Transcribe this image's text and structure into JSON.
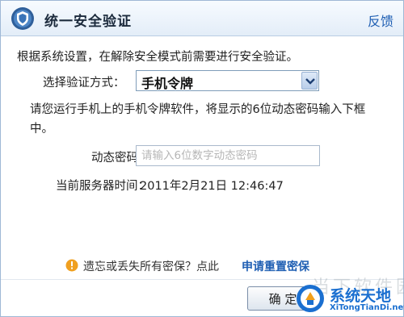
{
  "window": {
    "title": "统一安全验证",
    "feedback_link": "反馈"
  },
  "intro_text": "根据系统设置，在解除安全模式前需要进行安全验证。",
  "verify_method": {
    "label": "选择验证方式：",
    "selected": "手机令牌"
  },
  "description": "请您运行手机上的手机令牌软件，将显示的6位动态密码输入下框中。",
  "otp": {
    "label": "动态密码：",
    "placeholder": "请输入6位数字动态密码",
    "value": ""
  },
  "server_time": {
    "label": "当前服务器时间：",
    "value": "2011年2月21日 12:46:47"
  },
  "help": {
    "text": "遗忘或丢失所有密保？点此",
    "link": "申请重置密保"
  },
  "ok_button": "确 定",
  "watermark": {
    "background_text": "当下软件园",
    "name": "系统天地",
    "url": "XiTongTianDi.net"
  },
  "icons": {
    "title": "shield-icon",
    "dropdown": "chevron-down-icon",
    "help": "info-icon",
    "watermark": "site-logo-icon"
  },
  "colors": {
    "accent_link": "#1f5fb3",
    "titlebar": "#e3edf8",
    "help_icon": "#f0a020",
    "watermark": "#1a6fd0"
  }
}
